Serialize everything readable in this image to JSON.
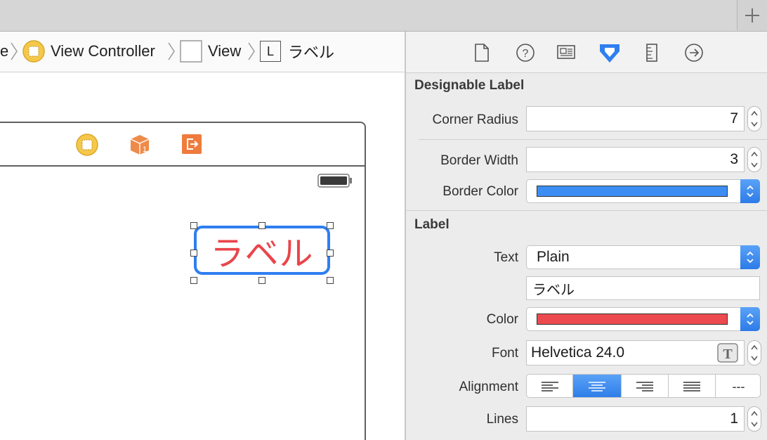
{
  "breadcrumb": {
    "items": [
      {
        "label": "e"
      },
      {
        "label": "View Controller"
      },
      {
        "label": "View"
      },
      {
        "label": "ラベル",
        "badge": "L"
      }
    ]
  },
  "canvas": {
    "label_text": "ラベル"
  },
  "inspector": {
    "designable_label": {
      "title": "Designable Label",
      "corner_radius_label": "Corner Radius",
      "corner_radius_value": "7",
      "border_width_label": "Border Width",
      "border_width_value": "3",
      "border_color_label": "Border Color",
      "border_color": "#3d8ef4"
    },
    "label": {
      "title": "Label",
      "text_label": "Text",
      "text_type": "Plain",
      "text_value": "ラベル",
      "color_label": "Color",
      "color": "#ec4a4e",
      "font_label": "Font",
      "font_value": "Helvetica 24.0",
      "alignment_label": "Alignment",
      "alignment_selected": "center",
      "justify_glyph": "---",
      "lines_label": "Lines",
      "lines_value": "1"
    }
  },
  "colors": {
    "accent": "#2e7ef0",
    "label_text": "#e8454a"
  }
}
